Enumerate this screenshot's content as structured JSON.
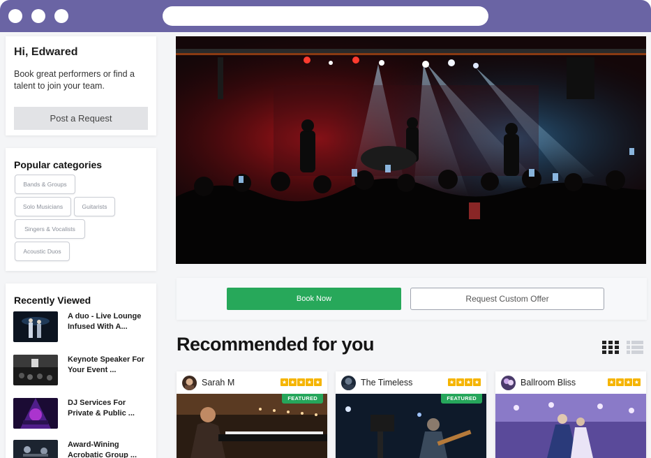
{
  "greeting": {
    "title": "Hi, Edwared",
    "text": "Book great performers or find a talent to join your team.",
    "button": "Post a Request"
  },
  "categories": {
    "title": "Popular categories",
    "chips": [
      "Bands & Groups",
      "Solo Musicians",
      "Guitarists",
      "Singers & Vocalists",
      "Acoustic Duos"
    ]
  },
  "recent": {
    "title": "Recently Viewed",
    "items": [
      {
        "label": "A duo - Live Lounge Infused With A..."
      },
      {
        "label": "Keynote Speaker For Your Event ..."
      },
      {
        "label": "DJ Services For Private & Public ..."
      },
      {
        "label": "Award-Wining Acrobatic Group ..."
      }
    ]
  },
  "actions": {
    "book": "Book Now",
    "custom": "Request Custom Offer"
  },
  "recommended": {
    "title": "Recommended for you",
    "cards": [
      {
        "name": "Sarah M",
        "featured": "FEATURED",
        "rating": 5
      },
      {
        "name": "The Timeless",
        "featured": "FEATURED",
        "rating": 4
      },
      {
        "name": "Ballroom Bliss",
        "featured": "",
        "rating": 4
      }
    ]
  },
  "colors": {
    "titlebar": "#6a64a4",
    "accent_green": "#27a85a",
    "star": "#f5b400"
  }
}
